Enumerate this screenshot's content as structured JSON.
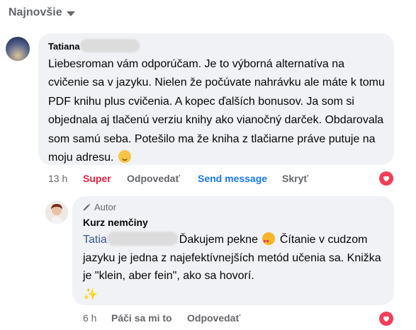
{
  "sort": {
    "label": "Najnovšie"
  },
  "comment": {
    "author": "Tatiana",
    "text": "Liebesroman vám odporúčam. Je to výborná alternatíva na cvičenie sa v jazyku. Nielen že počúvate nahrávku ale máte k tomu PDF knihu plus cvičenia. A kopec ďalších bonusov. Ja som si objednala aj tlačenú verziu knihy ako vianočný darček. Obdarovala som samú seba. Potešilo ma že kniha z tlačiarne práve putuje na moju adresu.",
    "emoji": "hugging-face-icon",
    "time": "13 h",
    "actions": {
      "reaction": "Super",
      "reply": "Odpovedať",
      "send_message": "Send message",
      "hide": "Skryť"
    },
    "reaction_icon": "heart-icon"
  },
  "reply": {
    "badge": "Autor",
    "author": "Kurz nemčiny",
    "mention": "Tatia",
    "text_before_emoji": "Ďakujem pekne",
    "text_after_emoji": "Čítanie v cudzom jazyku je jedna z najefektívnejších metód učenia sa. Knižka je \"klein, aber fein\", ako sa hovorí.",
    "emoji": "heart-eyes-icon",
    "trailing_emoji": "sparkles-icon",
    "time": "6 h",
    "actions": {
      "like": "Páči sa mi to",
      "reply": "Odpovedať"
    },
    "reaction_icon": "heart-icon"
  },
  "colors": {
    "accent": "#1877f2",
    "super_red": "#e41e3f",
    "heart": "#f33e58",
    "bubble": "#f0f2f5",
    "meta": "#65676b"
  }
}
